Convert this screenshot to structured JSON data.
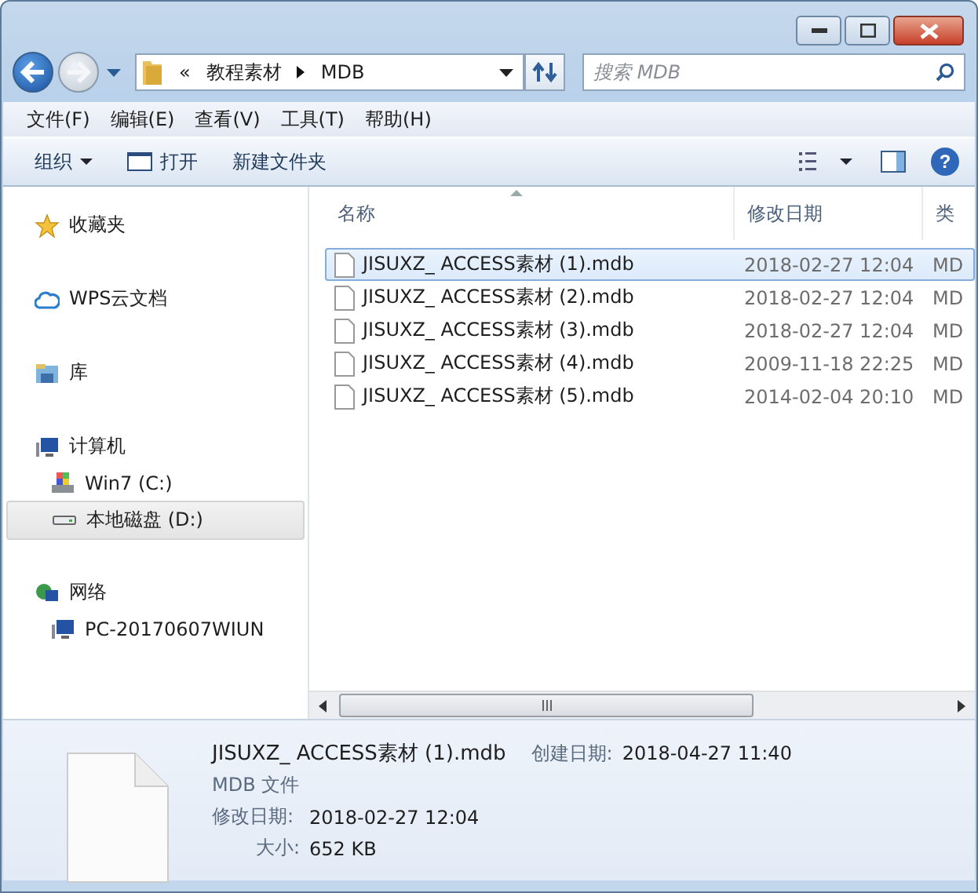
{
  "address": {
    "overflow": "«",
    "segments": [
      "教程素材",
      "MDB"
    ]
  },
  "search": {
    "placeholder": "搜索 MDB"
  },
  "menu": [
    "文件(F)",
    "编辑(E)",
    "查看(V)",
    "工具(T)",
    "帮助(H)"
  ],
  "toolbar": {
    "organize": "组织",
    "open": "打开",
    "new_folder": "新建文件夹",
    "help": "?"
  },
  "sidebar": [
    {
      "label": "收藏夹",
      "kind": "star",
      "selected": false
    },
    {
      "label": "WPS云文档",
      "kind": "cloud",
      "selected": false
    },
    {
      "label": "库",
      "kind": "library",
      "selected": false
    },
    {
      "label": "计算机",
      "kind": "computer",
      "selected": false,
      "children": [
        {
          "label": "Win7 (C:)",
          "kind": "system-drive",
          "selected": false
        },
        {
          "label": "本地磁盘 (D:)",
          "kind": "drive",
          "selected": true
        }
      ]
    },
    {
      "label": "网络",
      "kind": "network",
      "selected": false,
      "children": [
        {
          "label": "PC-20170607WIUN",
          "kind": "computer",
          "selected": false
        }
      ]
    }
  ],
  "columns": [
    "名称",
    "修改日期",
    "类"
  ],
  "rows": [
    {
      "name": "JISUXZ_ ACCESS素材 (1).mdb",
      "modified": "2018-02-27 12:04",
      "type": "MD",
      "selected": true
    },
    {
      "name": "JISUXZ_ ACCESS素材 (2).mdb",
      "modified": "2018-02-27 12:04",
      "type": "MD",
      "selected": false
    },
    {
      "name": "JISUXZ_ ACCESS素材 (3).mdb",
      "modified": "2018-02-27 12:04",
      "type": "MD",
      "selected": false
    },
    {
      "name": "JISUXZ_ ACCESS素材 (4).mdb",
      "modified": "2009-11-18 22:25",
      "type": "MD",
      "selected": false
    },
    {
      "name": "JISUXZ_ ACCESS素材 (5).mdb",
      "modified": "2014-02-04 20:10",
      "type": "MD",
      "selected": false
    }
  ],
  "details": {
    "name": "JISUXZ_ ACCESS素材 (1).mdb",
    "created_label": "创建日期:",
    "created": "2018-04-27 11:40",
    "type": "MDB 文件",
    "modified_label": "修改日期:",
    "modified": "2018-02-27 12:04",
    "size_label": "大小:",
    "size": "652 KB"
  }
}
